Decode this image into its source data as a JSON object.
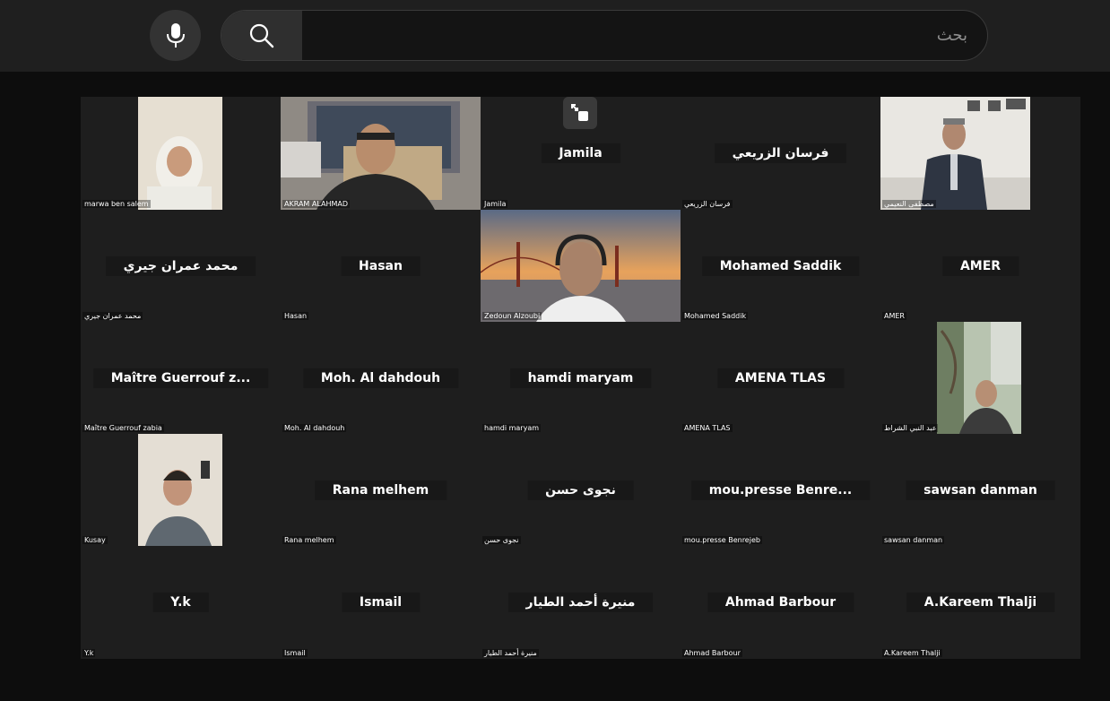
{
  "toolbar": {
    "mic_icon": "microphone-icon",
    "search_icon": "search-icon",
    "search_placeholder": "بحث"
  },
  "colors": {
    "topbar": "#1f1f1f",
    "tile_bg": "#1e1e1e",
    "page_bg": "#0d0d0d"
  },
  "participants": [
    {
      "name": "marwa ben salem",
      "tag": "marwa ben salem",
      "video": true
    },
    {
      "name": "AKRAM  ALAHMAD",
      "tag": "AKRAM  ALAHMAD",
      "video": true
    },
    {
      "name": "Jamila",
      "tag": "Jamila",
      "video": false
    },
    {
      "name": "فرسان الزريعي",
      "tag": "فرسان الزريعي",
      "video": false
    },
    {
      "name": "مصطفى النعيمي",
      "tag": "مصطفى النعيمي",
      "video": true
    },
    {
      "name": "محمد عمران  جيري",
      "tag": "محمد عمران  جيري",
      "video": false
    },
    {
      "name": "Hasan",
      "tag": "Hasan",
      "video": false
    },
    {
      "name": "Zedoun Alzoubi",
      "tag": "Zedoun Alzoubi",
      "video": true
    },
    {
      "name": "Mohamed Saddik",
      "tag": "Mohamed Saddik",
      "video": false
    },
    {
      "name": "AMER",
      "tag": "AMER",
      "video": false
    },
    {
      "name": "Maître  Guerrouf  z...",
      "tag": "Maître Guerrouf zabia",
      "video": false
    },
    {
      "name": "Moh. Al dahdouh",
      "tag": "Moh. Al dahdouh",
      "video": false
    },
    {
      "name": "hamdi maryam",
      "tag": "hamdi maryam",
      "video": false
    },
    {
      "name": "AMENA TLAS",
      "tag": "AMENA TLAS",
      "video": false
    },
    {
      "name": "عبد النبي الشراط",
      "tag": "عبد النبي الشراط",
      "video": true
    },
    {
      "name": "Kusay",
      "tag": "Kusay",
      "video": true
    },
    {
      "name": "Rana melhem",
      "tag": "Rana melhem",
      "video": false
    },
    {
      "name": "نجوى حسن",
      "tag": "نجوى حسن",
      "video": false
    },
    {
      "name": "mou.presse  Benre...",
      "tag": "mou.presse Benrejeb",
      "video": false
    },
    {
      "name": "sawsan danman",
      "tag": "sawsan danman",
      "video": false
    },
    {
      "name": "Y.k",
      "tag": "Y.k",
      "video": false
    },
    {
      "name": "Ismail",
      "tag": "Ismail",
      "video": false
    },
    {
      "name": "منيرة أحمد الطيار",
      "tag": "منيرة أحمد الطيار",
      "video": false
    },
    {
      "name": "Ahmad Barbour",
      "tag": "Ahmad Barbour",
      "video": false
    },
    {
      "name": "A.Kareem Thalji",
      "tag": "A.Kareem Thalji",
      "video": false
    }
  ]
}
